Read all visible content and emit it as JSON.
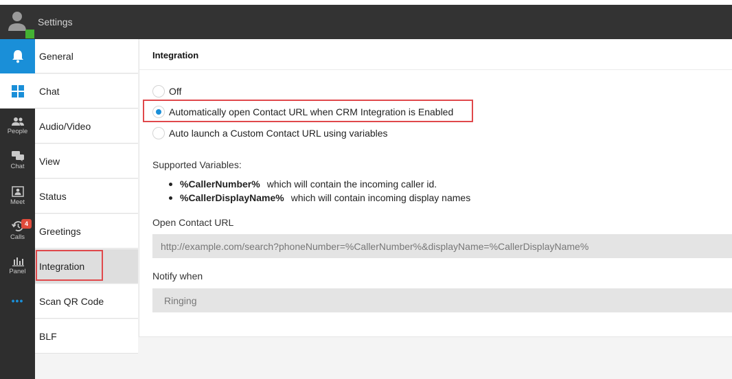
{
  "header": {
    "title": "Settings"
  },
  "rail": {
    "items": [
      {
        "label": "People",
        "icon": "people-icon"
      },
      {
        "label": "Chat",
        "icon": "chat-icon"
      },
      {
        "label": "Meet",
        "icon": "meet-icon"
      },
      {
        "label": "Calls",
        "icon": "calls-icon",
        "badge": "4"
      },
      {
        "label": "Panel",
        "icon": "panel-icon"
      }
    ],
    "more": "•••"
  },
  "menu": {
    "items": [
      {
        "label": "General"
      },
      {
        "label": "Chat"
      },
      {
        "label": "Audio/Video"
      },
      {
        "label": "View"
      },
      {
        "label": "Status"
      },
      {
        "label": "Greetings"
      },
      {
        "label": "Integration"
      },
      {
        "label": "Scan QR Code"
      },
      {
        "label": "BLF"
      }
    ],
    "active": "Integration"
  },
  "panel": {
    "title": "Integration",
    "options": [
      {
        "label": "Off",
        "checked": false
      },
      {
        "label": "Automatically open Contact URL when CRM Integration is Enabled",
        "checked": true
      },
      {
        "label": "Auto launch a Custom Contact URL using variables",
        "checked": false
      }
    ],
    "supported_label": "Supported Variables:",
    "variables": [
      {
        "name": "%CallerNumber%",
        "desc": "which will contain the incoming caller id."
      },
      {
        "name": "%CallerDisplayName%",
        "desc": "which will contain incoming display names"
      }
    ],
    "open_url_label": "Open Contact URL",
    "open_url_value": "http://example.com/search?phoneNumber=%CallerNumber%&displayName=%CallerDisplayName%",
    "notify_label": "Notify when",
    "notify_value": "Ringing"
  },
  "colors": {
    "accent": "#1a8fd8",
    "highlight": "#e0484b",
    "header": "#333333",
    "presence": "#44b233",
    "badge": "#e04b3b"
  }
}
